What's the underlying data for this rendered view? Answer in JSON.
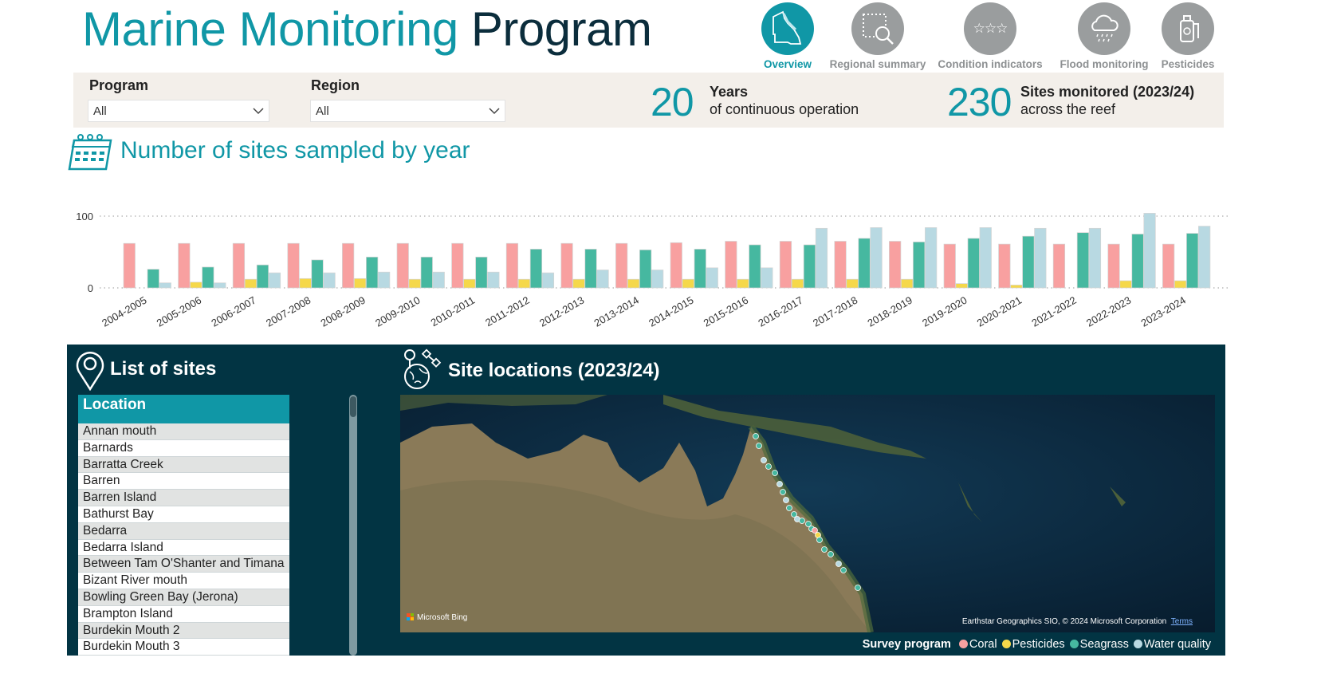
{
  "header": {
    "title_part1": "Marine Monitoring",
    "title_part2": "Program"
  },
  "nav": [
    {
      "label": "Overview",
      "icon": "queensland-map-icon",
      "active": true
    },
    {
      "label": "Regional summary",
      "icon": "magnify-region-icon",
      "active": false
    },
    {
      "label": "Condition indicators",
      "icon": "stars-icon",
      "active": false
    },
    {
      "label": "Flood monitoring",
      "icon": "rain-cloud-icon",
      "active": false
    },
    {
      "label": "Pesticides",
      "icon": "sprayer-icon",
      "active": false
    }
  ],
  "filters": {
    "program": {
      "label": "Program",
      "value": "All"
    },
    "region": {
      "label": "Region",
      "value": "All"
    }
  },
  "kpis": [
    {
      "value": "20",
      "title": "Years",
      "subtitle": "of continuous operation"
    },
    {
      "value": "230",
      "title": "Sites monitored (2023/24)",
      "subtitle": "across the reef"
    }
  ],
  "chart_section": {
    "title": "Number of sites sampled by year",
    "icon": "calendar-icon"
  },
  "chart_data": {
    "type": "bar",
    "title": "",
    "xlabel": "",
    "ylabel": "",
    "ylim": [
      0,
      105
    ],
    "yticks": [
      0,
      100
    ],
    "grid": true,
    "categories": [
      "2004-2005",
      "2005-2006",
      "2006-2007",
      "2007-2008",
      "2008-2009",
      "2009-2010",
      "2010-2011",
      "2011-2012",
      "2012-2013",
      "2013-2014",
      "2014-2015",
      "2015-2016",
      "2016-2017",
      "2017-2018",
      "2018-2019",
      "2019-2020",
      "2020-2021",
      "2021-2022",
      "2022-2023",
      "2023-2024"
    ],
    "series": [
      {
        "name": "Coral",
        "color": "#f8a0a0",
        "values": [
          62,
          62,
          62,
          62,
          62,
          62,
          62,
          62,
          62,
          62,
          63,
          65,
          65,
          65,
          65,
          61,
          61,
          61,
          61,
          61
        ]
      },
      {
        "name": "Pesticides",
        "color": "#f5d84a",
        "values": [
          0,
          8,
          12,
          13,
          13,
          12,
          12,
          12,
          12,
          12,
          12,
          12,
          12,
          12,
          12,
          6,
          4,
          0,
          10,
          10
        ]
      },
      {
        "name": "Seagrass",
        "color": "#46b8a0",
        "values": [
          26,
          29,
          32,
          39,
          43,
          43,
          43,
          54,
          54,
          53,
          54,
          60,
          60,
          69,
          64,
          69,
          72,
          77,
          75,
          76
        ]
      },
      {
        "name": "Water quality",
        "color": "#b8d9e2",
        "values": [
          7,
          7,
          21,
          21,
          22,
          22,
          22,
          21,
          25,
          25,
          28,
          28,
          83,
          84,
          84,
          84,
          83,
          83,
          104,
          86
        ]
      }
    ]
  },
  "sites": {
    "title": "List of sites",
    "column": "Location",
    "items": [
      "Annan mouth",
      "Barnards",
      "Barratta Creek",
      "Barren",
      "Barren Island",
      "Bathurst Bay",
      "Bedarra",
      "Bedarra Island",
      "Between Tam O'Shanter and Timana",
      "Bizant River mouth",
      "Bowling Green Bay (Jerona)",
      "Brampton Island",
      "Burdekin Mouth 2",
      "Burdekin Mouth 3"
    ]
  },
  "map": {
    "title": "Site locations (2023/24)",
    "attribution": "Earthstar Geographics SIO, © 2024 Microsoft Corporation",
    "terms": "Terms",
    "logo": "Microsoft Bing"
  },
  "legend": {
    "title": "Survey program",
    "items": [
      {
        "label": "Coral",
        "color": "#f8a0a0"
      },
      {
        "label": "Pesticides",
        "color": "#f5d84a"
      },
      {
        "label": "Seagrass",
        "color": "#46b8a0"
      },
      {
        "label": "Water quality",
        "color": "#b8d9e2"
      }
    ]
  }
}
